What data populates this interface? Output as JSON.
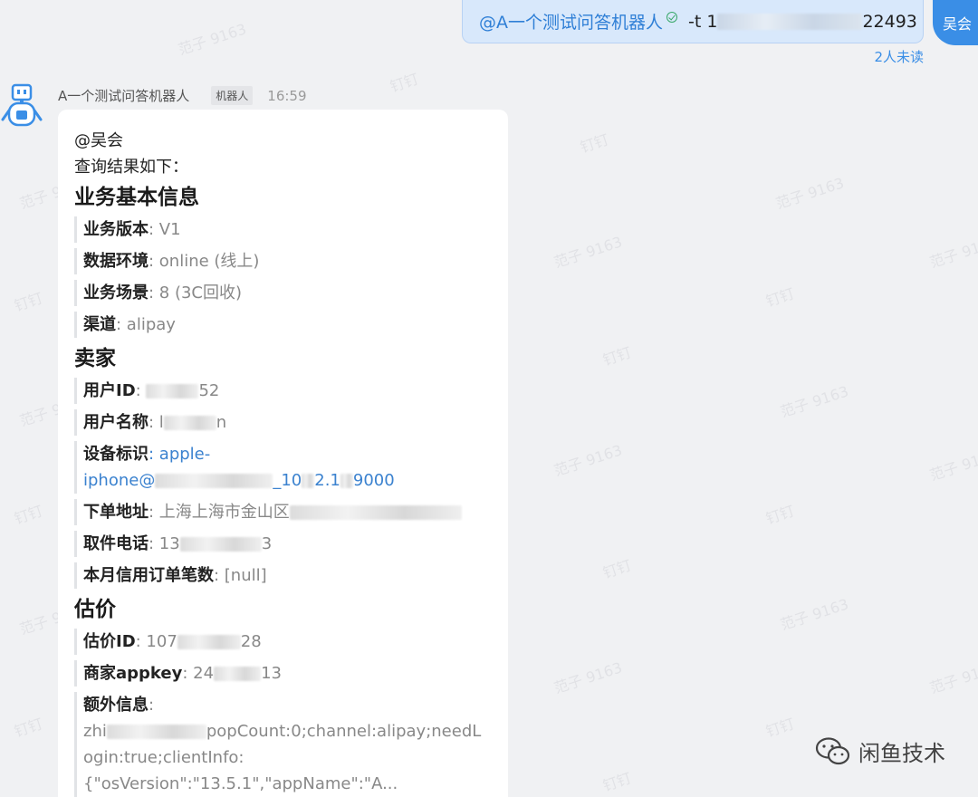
{
  "watermark": {
    "text": "范子 9163",
    "alt": "钉钉"
  },
  "outgoing": {
    "mention": "@A一个测试问答机器人",
    "command_prefix": "-t 1",
    "command_suffix": "22493",
    "sender_avatar": "吴会",
    "read_status": "2人未读"
  },
  "incoming": {
    "sender_name": "A一个测试问答机器人",
    "badge": "机器人",
    "time": "16:59",
    "mention": "@吴会",
    "intro": "查询结果如下：",
    "sections": {
      "basic": {
        "title": "业务基本信息",
        "version_key": "业务版本",
        "version_val": ": V1",
        "env_key": "数据环境",
        "env_val": ": online (线上)",
        "scene_key": "业务场景",
        "scene_val": ": 8 (3C回收)",
        "channel_key": "渠道",
        "channel_val": ": alipay"
      },
      "seller": {
        "title": "卖家",
        "uid_key": "用户ID",
        "uid_val_a": ": ",
        "uid_val_b": "52",
        "uname_key": "用户名称",
        "uname_val_a": ": l",
        "uname_val_b": "n",
        "device_key": "设备标识",
        "device_val_a": ": apple-",
        "device_val_b": "iphone@",
        "device_val_c": "_10",
        "device_val_d": "2.1",
        "device_val_e": "9000",
        "addr_key": "下单地址",
        "addr_val": ": 上海上海市金山区",
        "phone_key": "取件电话",
        "phone_val_a": ": 13",
        "phone_val_b": "3",
        "credit_key": "本月信用订单笔数",
        "credit_val": ": [null]"
      },
      "estimate": {
        "title": "估价",
        "eid_key": "估价ID",
        "eid_val_a": ": 107",
        "eid_val_b": "28",
        "appkey_key": "商家appkey",
        "appkey_val_a": ": 24",
        "appkey_val_b": "13",
        "extra_key": "额外信息",
        "extra_val_a": ":",
        "extra_val_b": "zhi",
        "extra_val_c": "popCount:0;channel:alipay;needLogin:true;clientInfo:",
        "extra_val_d": "{\"osVersion\":\"13.5.1\",\"appName\":\"A..."
      }
    }
  },
  "wechat_mark": {
    "text": "闲鱼技术",
    "icon": "wechat-icon"
  }
}
